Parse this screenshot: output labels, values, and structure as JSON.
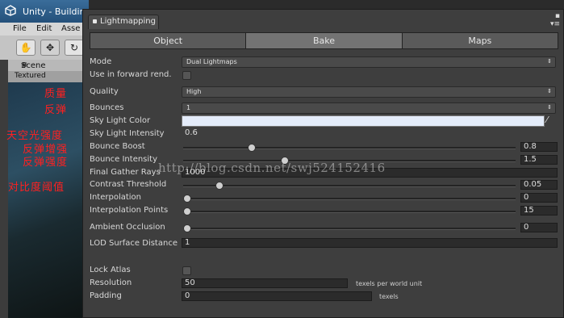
{
  "background_editor": {
    "window_title": "Unity - Buildin",
    "menu": [
      "File",
      "Edit",
      "Asse"
    ],
    "scene_tab": "Scene",
    "scene_mode": "Textured"
  },
  "annotations": [
    "质量",
    "反弹",
    "天空光强度",
    "反弹增强",
    "反弹强度",
    "对比度阈值"
  ],
  "lightmapping": {
    "window_tab": "Lightmapping",
    "tabs": [
      {
        "label": "Object",
        "active": false
      },
      {
        "label": "Bake",
        "active": true
      },
      {
        "label": "Maps",
        "active": false
      }
    ],
    "mode": {
      "label": "Mode",
      "value": "Dual Lightmaps"
    },
    "use_forward": {
      "label": "Use in forward rend.",
      "checked": false
    },
    "quality": {
      "label": "Quality",
      "value": "High"
    },
    "bounces": {
      "label": "Bounces",
      "value": "1"
    },
    "sky_light_color": {
      "label": "Sky Light Color",
      "color": "#e4ecfa"
    },
    "sky_light_intensity": {
      "label": "Sky Light Intensity",
      "value": "0.6"
    },
    "sliders": [
      {
        "key": "bounce_boost",
        "label": "Bounce Boost",
        "value": "0.8",
        "fraction": 0.2
      },
      {
        "key": "bounce_intensity",
        "label": "Bounce Intensity",
        "value": "1.5",
        "fraction": 0.3
      },
      {
        "key": "contrast_threshold",
        "label": "Contrast Threshold",
        "value": "0.05",
        "fraction": 0.1
      },
      {
        "key": "interpolation",
        "label": "Interpolation",
        "value": "0",
        "fraction": 0.0
      },
      {
        "key": "interpolation_points",
        "label": "Interpolation Points",
        "value": "15",
        "fraction": 0.0
      },
      {
        "key": "ambient_occlusion",
        "label": "Ambient Occlusion",
        "value": "0",
        "fraction": 0.0
      }
    ],
    "final_gather_rays": {
      "label": "Final Gather Rays",
      "value": "1000"
    },
    "lod_surface_distance": {
      "label": "LOD Surface Distance",
      "value": "1"
    },
    "lock_atlas": {
      "label": "Lock Atlas",
      "checked": false
    },
    "resolution": {
      "label": "Resolution",
      "value": "50",
      "unit": "texels per world unit"
    },
    "padding": {
      "label": "Padding",
      "value": "0",
      "unit": "texels"
    }
  },
  "watermark": "http://blog.csdn.net/swj524152416",
  "colors": {
    "annotation": "#ff2020",
    "panel": "#3e3e3e",
    "active_tab": "#737373"
  }
}
